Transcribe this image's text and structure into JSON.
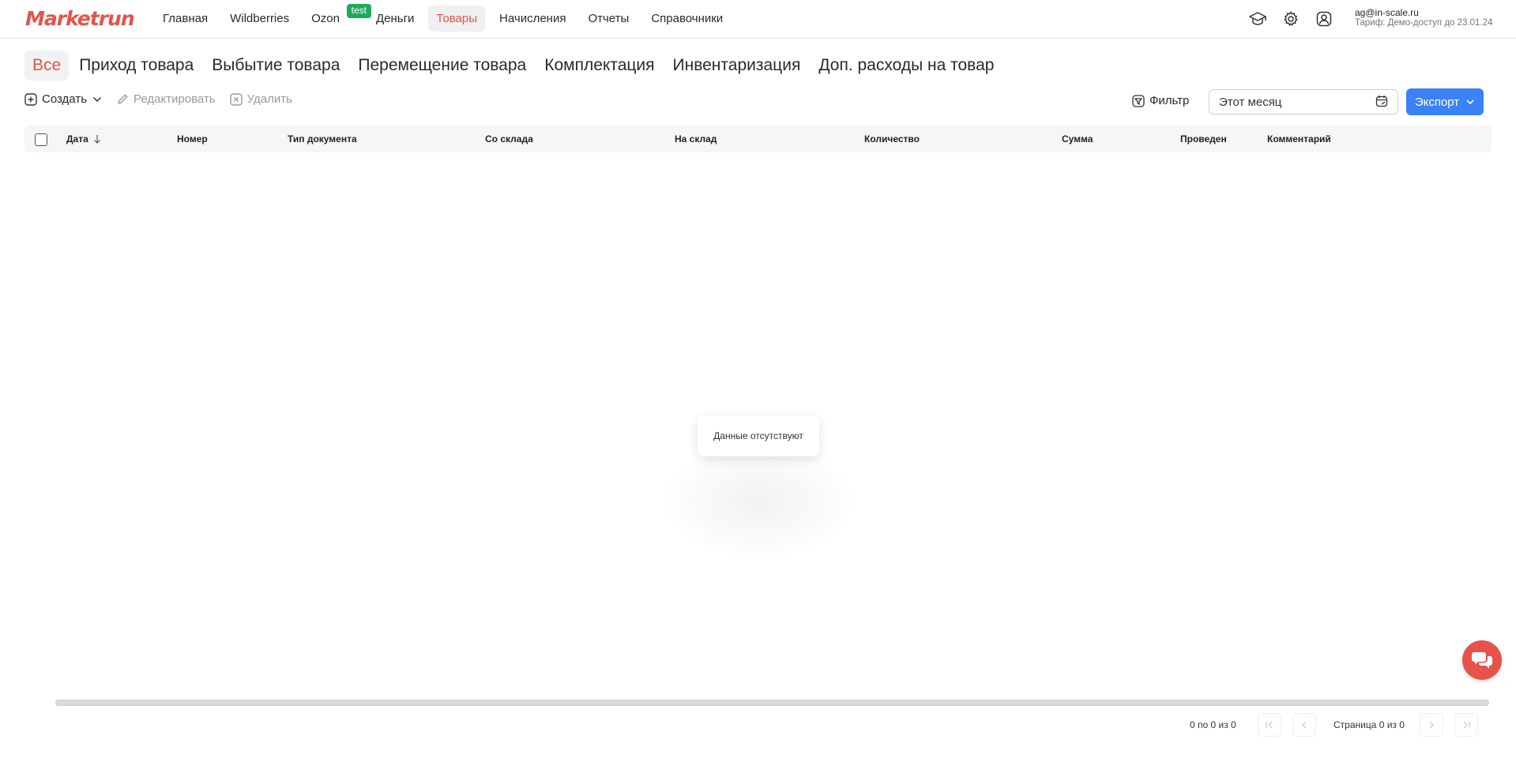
{
  "app": {
    "logo_text": "Marketrun"
  },
  "nav": {
    "items": [
      {
        "label": "Главная"
      },
      {
        "label": "Wildberries"
      },
      {
        "label": "Ozon",
        "badge": "test"
      },
      {
        "label": "Деньги"
      },
      {
        "label": "Товары",
        "active": true
      },
      {
        "label": "Начисления"
      },
      {
        "label": "Отчеты"
      },
      {
        "label": "Справочники"
      }
    ]
  },
  "header_icons": [
    "graduation-cap-icon",
    "gear-icon",
    "user-icon"
  ],
  "user": {
    "email": "ag@in-scale.ru",
    "plan": "Тариф: Демо-доступ до 23.01.24"
  },
  "tabs": [
    {
      "label": "Все",
      "active": true
    },
    {
      "label": "Приход товара"
    },
    {
      "label": "Выбытие товара"
    },
    {
      "label": "Перемещение товара"
    },
    {
      "label": "Комплектация"
    },
    {
      "label": "Инвентаризация"
    },
    {
      "label": "Доп. расходы на товар"
    }
  ],
  "toolbar": {
    "create_label": "Создать",
    "edit_label": "Редактировать",
    "delete_label": "Удалить",
    "filter_label": "Фильтр",
    "period_value": "Этот месяц",
    "export_label": "Экспорт"
  },
  "table": {
    "columns": [
      {
        "label": "Дата",
        "sort": "desc"
      },
      {
        "label": "Номер"
      },
      {
        "label": "Тип документа"
      },
      {
        "label": "Со склада"
      },
      {
        "label": "На склад"
      },
      {
        "label": "Количество"
      },
      {
        "label": "Сумма"
      },
      {
        "label": "Проведен"
      },
      {
        "label": "Комментарий"
      }
    ],
    "rows": [],
    "empty_text": "Данные отсутствуют"
  },
  "pagination": {
    "range_text": "0 по 0 из 0",
    "page_text": "Страница 0 из 0"
  },
  "colors": {
    "accent": "#e5534b",
    "primary": "#3b82f6",
    "badge": "#1faa5b"
  }
}
